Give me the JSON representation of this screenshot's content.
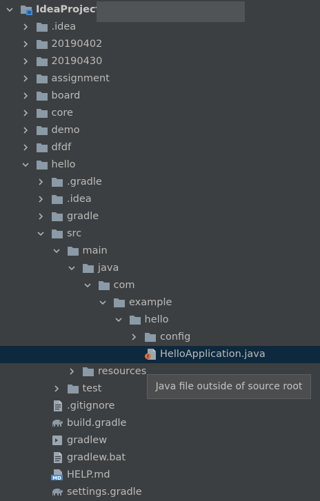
{
  "tree": [
    {
      "label": "IdeaProjects",
      "depth": 0,
      "arrow": "down",
      "icon": "project-folder-icon",
      "bold": true,
      "redacted": true
    },
    {
      "label": ".idea",
      "depth": 1,
      "arrow": "right",
      "icon": "folder-icon"
    },
    {
      "label": "20190402",
      "depth": 1,
      "arrow": "right",
      "icon": "folder-icon"
    },
    {
      "label": "20190430",
      "depth": 1,
      "arrow": "right",
      "icon": "folder-icon"
    },
    {
      "label": "assignment",
      "depth": 1,
      "arrow": "right",
      "icon": "folder-icon"
    },
    {
      "label": "board",
      "depth": 1,
      "arrow": "right",
      "icon": "folder-icon"
    },
    {
      "label": "core",
      "depth": 1,
      "arrow": "right",
      "icon": "folder-icon"
    },
    {
      "label": "demo",
      "depth": 1,
      "arrow": "right",
      "icon": "folder-icon"
    },
    {
      "label": "dfdf",
      "depth": 1,
      "arrow": "right",
      "icon": "folder-icon"
    },
    {
      "label": "hello",
      "depth": 1,
      "arrow": "down",
      "icon": "folder-icon"
    },
    {
      "label": ".gradle",
      "depth": 2,
      "arrow": "right",
      "icon": "folder-icon"
    },
    {
      "label": ".idea",
      "depth": 2,
      "arrow": "right",
      "icon": "folder-icon"
    },
    {
      "label": "gradle",
      "depth": 2,
      "arrow": "right",
      "icon": "folder-icon"
    },
    {
      "label": "src",
      "depth": 2,
      "arrow": "down",
      "icon": "folder-icon"
    },
    {
      "label": "main",
      "depth": 3,
      "arrow": "down",
      "icon": "folder-icon"
    },
    {
      "label": "java",
      "depth": 4,
      "arrow": "down",
      "icon": "folder-icon"
    },
    {
      "label": "com",
      "depth": 5,
      "arrow": "down",
      "icon": "folder-icon"
    },
    {
      "label": "example",
      "depth": 6,
      "arrow": "down",
      "icon": "folder-icon"
    },
    {
      "label": "hello",
      "depth": 7,
      "arrow": "down",
      "icon": "folder-icon"
    },
    {
      "label": "config",
      "depth": 8,
      "arrow": "right",
      "icon": "folder-icon"
    },
    {
      "label": "HelloApplication.java",
      "depth": 8,
      "arrow": "none",
      "icon": "java-file-icon",
      "selected": true
    },
    {
      "label": "resources",
      "depth": 4,
      "arrow": "right",
      "icon": "folder-icon"
    },
    {
      "label": "test",
      "depth": 3,
      "arrow": "right",
      "icon": "folder-icon"
    },
    {
      "label": ".gitignore",
      "depth": 2,
      "arrow": "none",
      "icon": "text-file-icon"
    },
    {
      "label": "build.gradle",
      "depth": 2,
      "arrow": "none",
      "icon": "gradle-elephant-icon"
    },
    {
      "label": "gradlew",
      "depth": 2,
      "arrow": "none",
      "icon": "terminal-file-icon"
    },
    {
      "label": "gradlew.bat",
      "depth": 2,
      "arrow": "none",
      "icon": "text-file-icon"
    },
    {
      "label": "HELP.md",
      "depth": 2,
      "arrow": "none",
      "icon": "markdown-file-icon"
    },
    {
      "label": "settings.gradle",
      "depth": 2,
      "arrow": "none",
      "icon": "gradle-elephant-icon"
    }
  ],
  "tooltip": {
    "text": "Java file outside of source root"
  },
  "colors": {
    "background": "#3c3f41",
    "selection": "#0d293e",
    "text": "#bbbbbb",
    "folder": "#8a9aa6",
    "java_badge": "#d9753a",
    "markdown": "#3d8bd8"
  }
}
